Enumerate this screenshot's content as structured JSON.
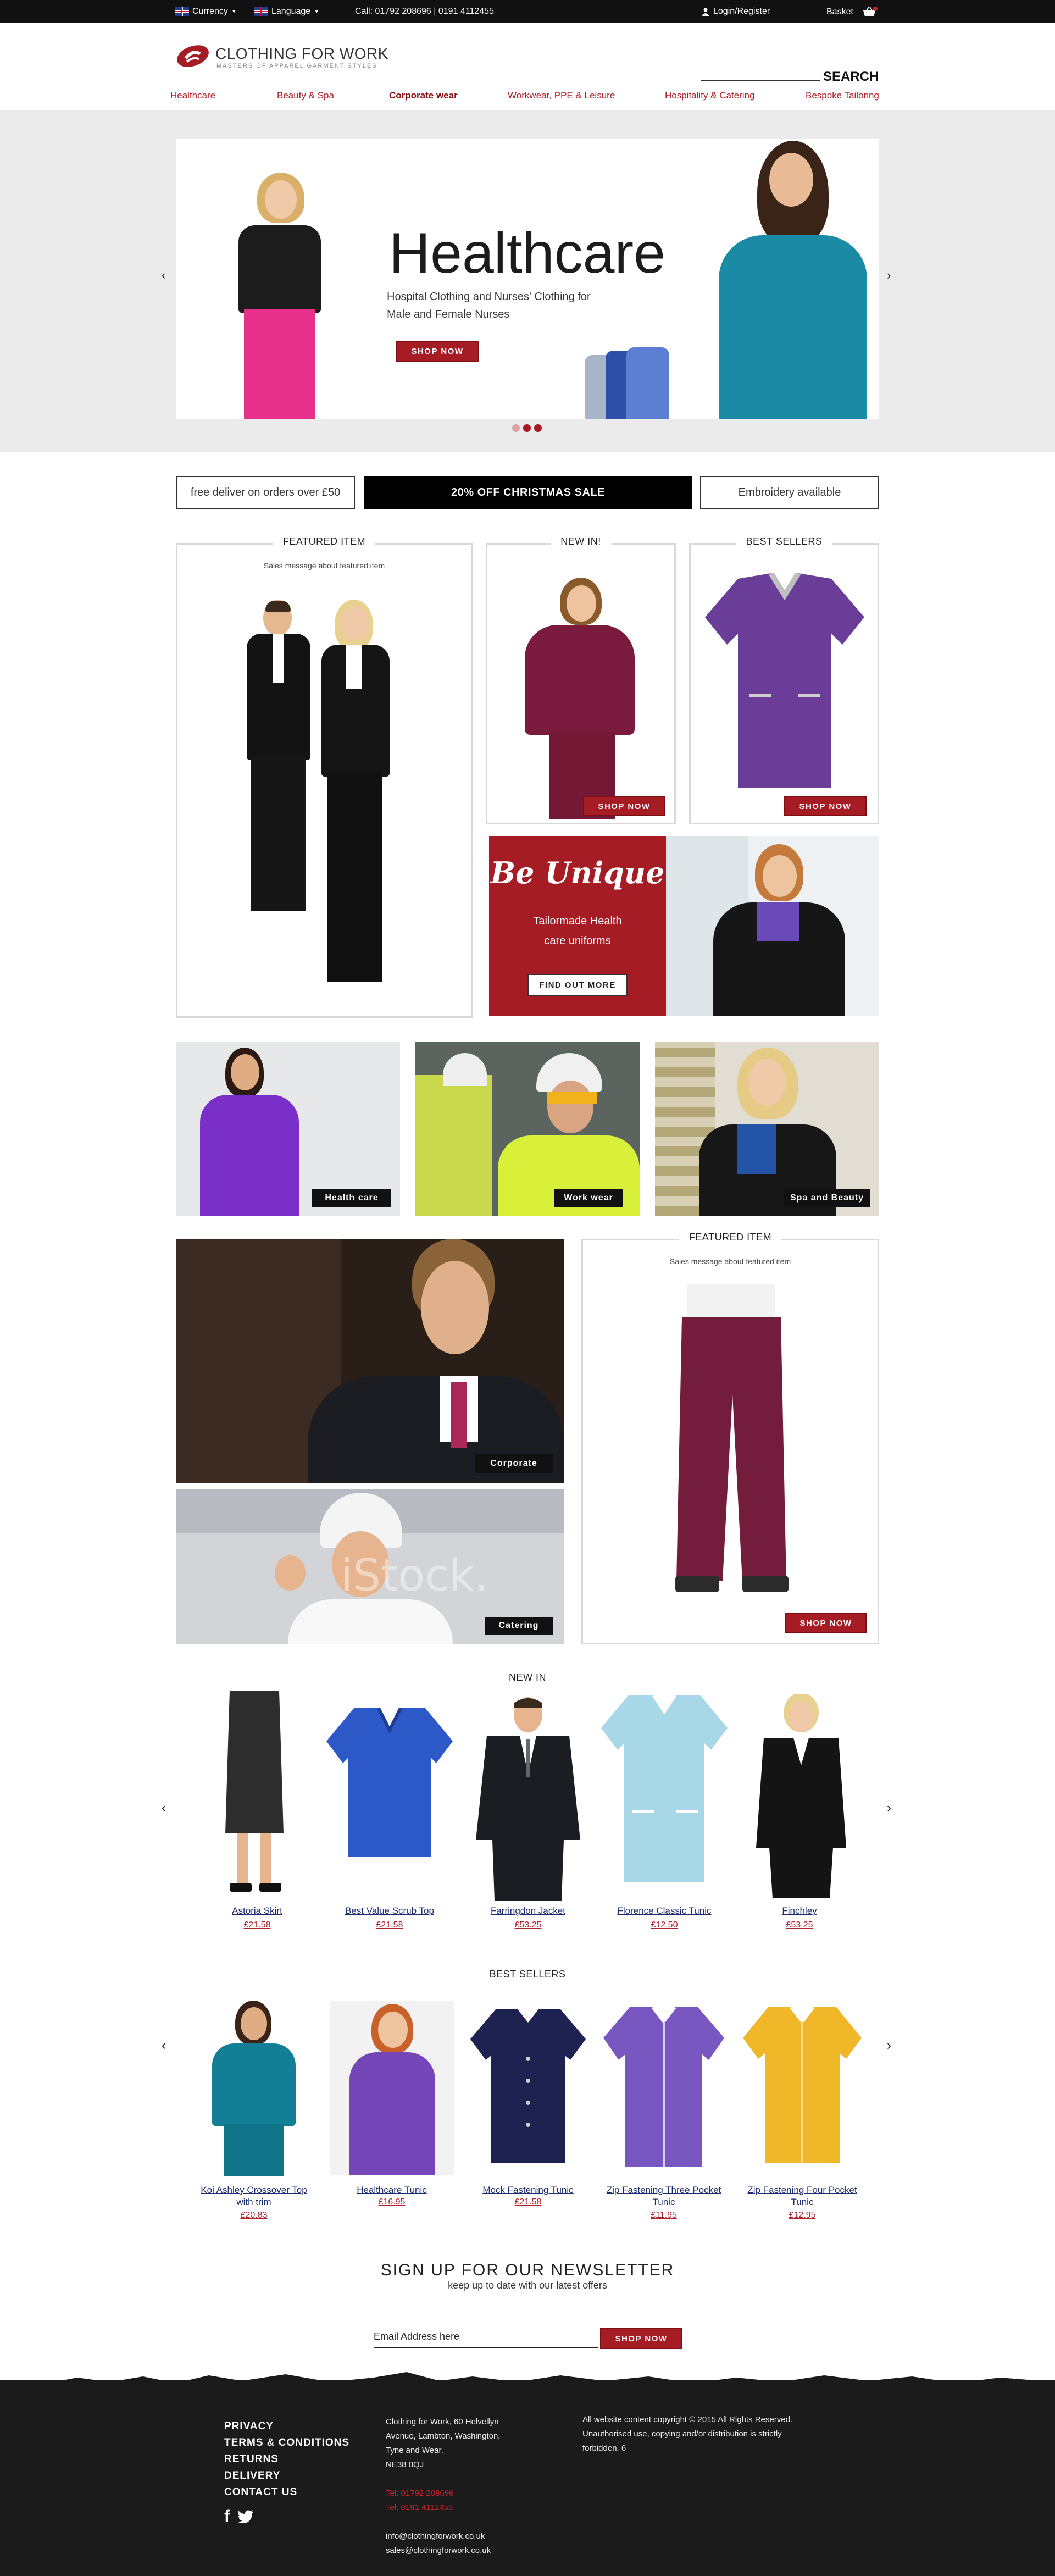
{
  "topbar": {
    "currency_label": "Currency",
    "language_label": "Language",
    "phone": "Call: 01792 208696  |  0191 4112455",
    "login": "Login/Register",
    "basket": "Basket"
  },
  "header": {
    "logo_title": "CLOTHING FOR WORK",
    "logo_sub": "MASTERS OF APPAREL GARMENT STYLES",
    "search_label": "SEARCH"
  },
  "nav": {
    "items": [
      "Healthcare",
      "Beauty & Spa",
      "Corporate wear",
      "Workwear, PPE & Leisure",
      "Hospitality & Catering",
      "Bespoke Tailoring"
    ],
    "active_index": 2
  },
  "hero": {
    "title": "Healthcare",
    "text": "Hospital Clothing and Nurses' Clothing for Male and Female Nurses",
    "button": "SHOP NOW",
    "slides": 3,
    "active_slide": 2
  },
  "promo": {
    "left": "free deliver on orders over £50",
    "center": "20% OFF CHRISTMAS SALE",
    "right": "Embroidery available"
  },
  "featured1": {
    "title": "FEATURED ITEM",
    "sub": "Sales message about featured item"
  },
  "new_card": {
    "title": "NEW IN!",
    "button": "SHOP NOW"
  },
  "best_card": {
    "title": "BEST SELLERS",
    "button": "SHOP NOW"
  },
  "be_unique": {
    "title": "Be Unique",
    "line1": "Tailormade Health",
    "line2": "care uniforms",
    "button": "FIND OUT MORE"
  },
  "categories": [
    {
      "label": "Health care"
    },
    {
      "label": "Work wear"
    },
    {
      "label": "Spa and Beauty"
    }
  ],
  "corporate": {
    "label": "Corporate"
  },
  "catering": {
    "label": "Catering",
    "watermark": "iStock."
  },
  "featured2": {
    "title": "FEATURED ITEM",
    "sub": "Sales message about featured item",
    "button": "SHOP NOW"
  },
  "new_in": {
    "title": "NEW IN",
    "products": [
      {
        "name": "Astoria Skirt",
        "price": "£21.58"
      },
      {
        "name": "Best Value Scrub Top",
        "price": "£21.58"
      },
      {
        "name": "Farringdon Jacket",
        "price": "£53.25"
      },
      {
        "name": "Florence Classic Tunic",
        "price": "£12.50"
      },
      {
        "name": "Finchley",
        "price": "£53.25"
      }
    ]
  },
  "best_sellers": {
    "title": "BEST SELLERS",
    "products": [
      {
        "name": "Koi Ashley Crossover Top with trim",
        "price": "£20.83"
      },
      {
        "name": "Healthcare Tunic",
        "price": "£16.95"
      },
      {
        "name": "Mock Fastening Tunic",
        "price": "£21.58"
      },
      {
        "name": "Zip Fastening Three Pocket Tunic",
        "price": "£11.95"
      },
      {
        "name": "Zip Fastening Four Pocket Tunic",
        "price": "£12.95"
      }
    ]
  },
  "newsletter": {
    "title": "SIGN UP FOR OUR NEWSLETTER",
    "sub": "keep up to date with our latest offers",
    "placeholder": "Email Address here",
    "button": "SHOP NOW"
  },
  "footer": {
    "links": [
      "PRIVACY",
      "TERMS & CONDITIONS",
      "RETURNS",
      "DELIVERY",
      "CONTACT US"
    ],
    "address": [
      "Clothing for Work, 60 Helvellyn",
      "Avenue, Lambton, Washington,",
      "Tyne and Wear,",
      "NE38 0QJ"
    ],
    "tel1": "Tel: 01792 208696",
    "tel2": "Tel: 0191 4112455",
    "email1": "info@clothingforwork.co.uk",
    "email2": "sales@clothingforwork.co.uk",
    "legal": [
      "All website content copyright © 2015 All Rights Reserved.",
      "Unauthorised use, copying and/or distribution is strictly",
      "forbidden. 6"
    ]
  },
  "colors": {
    "brand_red": "#a51c24",
    "topbar": "#111111",
    "footer": "#1b1b1b",
    "link_blue": "#1a2b70"
  }
}
